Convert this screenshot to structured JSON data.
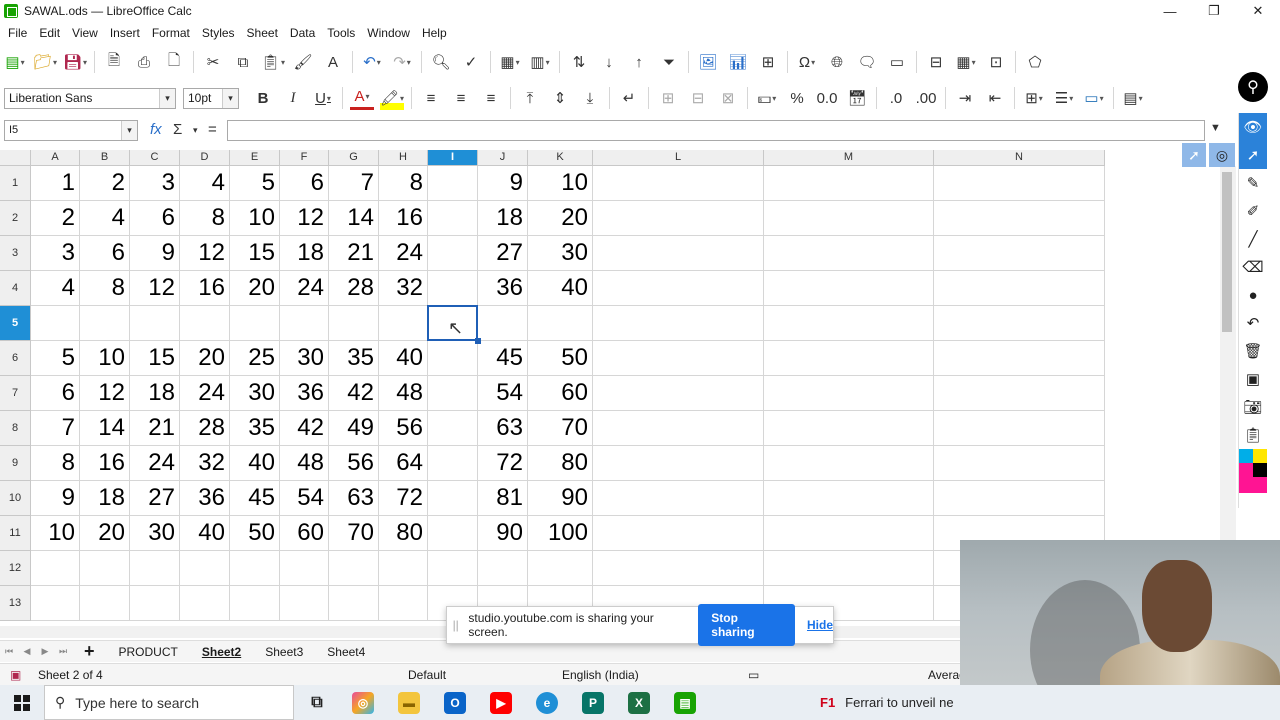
{
  "window": {
    "title": "SAWAL.ods — LibreOffice Calc"
  },
  "menu": [
    "File",
    "Edit",
    "View",
    "Insert",
    "Format",
    "Styles",
    "Sheet",
    "Data",
    "Tools",
    "Window",
    "Help"
  ],
  "formatting": {
    "font_name": "Liberation Sans",
    "font_size": "10pt"
  },
  "formula_bar": {
    "cell_ref": "I5",
    "formula": "",
    "fx": "fx",
    "sigma": "Σ",
    "equals": "="
  },
  "columns": [
    "A",
    "B",
    "C",
    "D",
    "E",
    "F",
    "G",
    "H",
    "I",
    "J",
    "K",
    "L",
    "M",
    "N"
  ],
  "selected_column": "I",
  "rows": [
    "1",
    "2",
    "3",
    "4",
    "5",
    "6",
    "7",
    "8",
    "9",
    "10",
    "11",
    "12",
    "13"
  ],
  "selected_row": "5",
  "cells": [
    [
      "1",
      "2",
      "3",
      "4",
      "5",
      "6",
      "7",
      "8",
      "",
      "9",
      "10"
    ],
    [
      "2",
      "4",
      "6",
      "8",
      "10",
      "12",
      "14",
      "16",
      "",
      "18",
      "20"
    ],
    [
      "3",
      "6",
      "9",
      "12",
      "15",
      "18",
      "21",
      "24",
      "",
      "27",
      "30"
    ],
    [
      "4",
      "8",
      "12",
      "16",
      "20",
      "24",
      "28",
      "32",
      "",
      "36",
      "40"
    ],
    [
      "",
      "",
      "",
      "",
      "",
      "",
      "",
      "",
      "",
      "",
      ""
    ],
    [
      "5",
      "10",
      "15",
      "20",
      "25",
      "30",
      "35",
      "40",
      "",
      "45",
      "50"
    ],
    [
      "6",
      "12",
      "18",
      "24",
      "30",
      "36",
      "42",
      "48",
      "",
      "54",
      "60"
    ],
    [
      "7",
      "14",
      "21",
      "28",
      "35",
      "42",
      "49",
      "56",
      "",
      "63",
      "70"
    ],
    [
      "8",
      "16",
      "24",
      "32",
      "40",
      "48",
      "56",
      "64",
      "",
      "72",
      "80"
    ],
    [
      "9",
      "18",
      "27",
      "36",
      "45",
      "54",
      "63",
      "72",
      "",
      "81",
      "90"
    ],
    [
      "10",
      "20",
      "30",
      "40",
      "50",
      "60",
      "70",
      "80",
      "",
      "90",
      "100"
    ],
    [
      "",
      "",
      "",
      "",
      "",
      "",
      "",
      "",
      "",
      "",
      ""
    ],
    [
      "",
      "",
      "",
      "",
      "",
      "",
      "",
      "",
      "",
      "",
      ""
    ]
  ],
  "sheet_tabs": [
    "PRODUCT",
    "Sheet2",
    "Sheet3",
    "Sheet4"
  ],
  "active_sheet": "Sheet2",
  "add_sheet": "+",
  "status": {
    "sheet_info": "Sheet 2 of 4",
    "page_style": "Default",
    "language": "English (India)",
    "agg": "Averag"
  },
  "share_toast": {
    "message": "studio.youtube.com is sharing your screen.",
    "stop": "Stop sharing",
    "hide": "Hide"
  },
  "taskbar": {
    "search_placeholder": "Type here to search",
    "news": "Ferrari to unveil ne"
  },
  "colors": {
    "accent": "#1f8fd6",
    "cursor": "#1f5fb6",
    "calc_green": "#18a303",
    "share_blue": "#1a73e8"
  }
}
